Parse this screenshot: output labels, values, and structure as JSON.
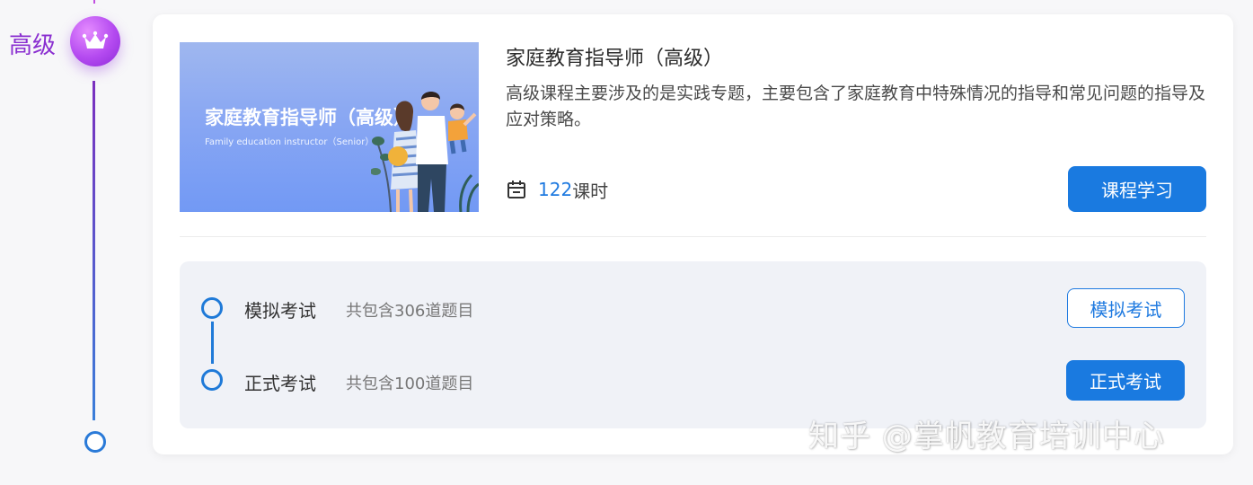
{
  "level": {
    "label": "高级",
    "badge_icon": "crown-icon",
    "accent_color": "#b44af0"
  },
  "course": {
    "banner": {
      "title": "家庭教育指导师（高级）",
      "subtitle": "Family education instructor（Senior）"
    },
    "title": "家庭教育指导师（高级）",
    "description": "高级课程主要涉及的是实践专题，主要包含了家庭教育中特殊情况的指导和常见问题的指导及应对策略。",
    "hours_value": "122",
    "hours_unit": "课时",
    "hours_icon": "calendar-icon",
    "study_button": "课程学习"
  },
  "exams": [
    {
      "name": "模拟考试",
      "info": "共包含306道题目",
      "button": "模拟考试",
      "button_style": "outline"
    },
    {
      "name": "正式考试",
      "info": "共包含100道题目",
      "button": "正式考试",
      "button_style": "primary"
    }
  ],
  "colors": {
    "primary": "#1a7ae0",
    "timeline_top": "#7b2fbf",
    "timeline_bottom": "#3a7ed9"
  },
  "watermark": "知乎 @掌帆教育培训中心"
}
